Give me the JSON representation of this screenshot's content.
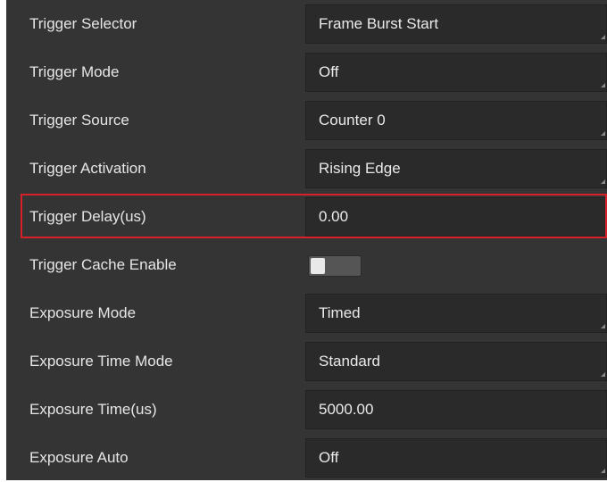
{
  "rows": [
    {
      "label": "Trigger Selector",
      "value": "Frame Burst Start",
      "control": "dropdown"
    },
    {
      "label": "Trigger Mode",
      "value": "Off",
      "control": "dropdown"
    },
    {
      "label": "Trigger Source",
      "value": "Counter 0",
      "control": "dropdown"
    },
    {
      "label": "Trigger Activation",
      "value": "Rising Edge",
      "control": "dropdown"
    },
    {
      "label": "Trigger Delay(us)",
      "value": "0.00",
      "control": "input",
      "highlighted": true
    },
    {
      "label": "Trigger Cache Enable",
      "value": "",
      "control": "toggle",
      "toggle_on": false
    },
    {
      "label": "Exposure Mode",
      "value": "Timed",
      "control": "dropdown"
    },
    {
      "label": "Exposure Time Mode",
      "value": "Standard",
      "control": "dropdown"
    },
    {
      "label": "Exposure Time(us)",
      "value": "5000.00",
      "control": "input"
    },
    {
      "label": "Exposure Auto",
      "value": "Off",
      "control": "dropdown"
    }
  ],
  "colors": {
    "panel_bg": "#343434",
    "field_bg": "#2a2a2a",
    "text": "#e6e6e6",
    "highlight_border": "#d6202a"
  }
}
